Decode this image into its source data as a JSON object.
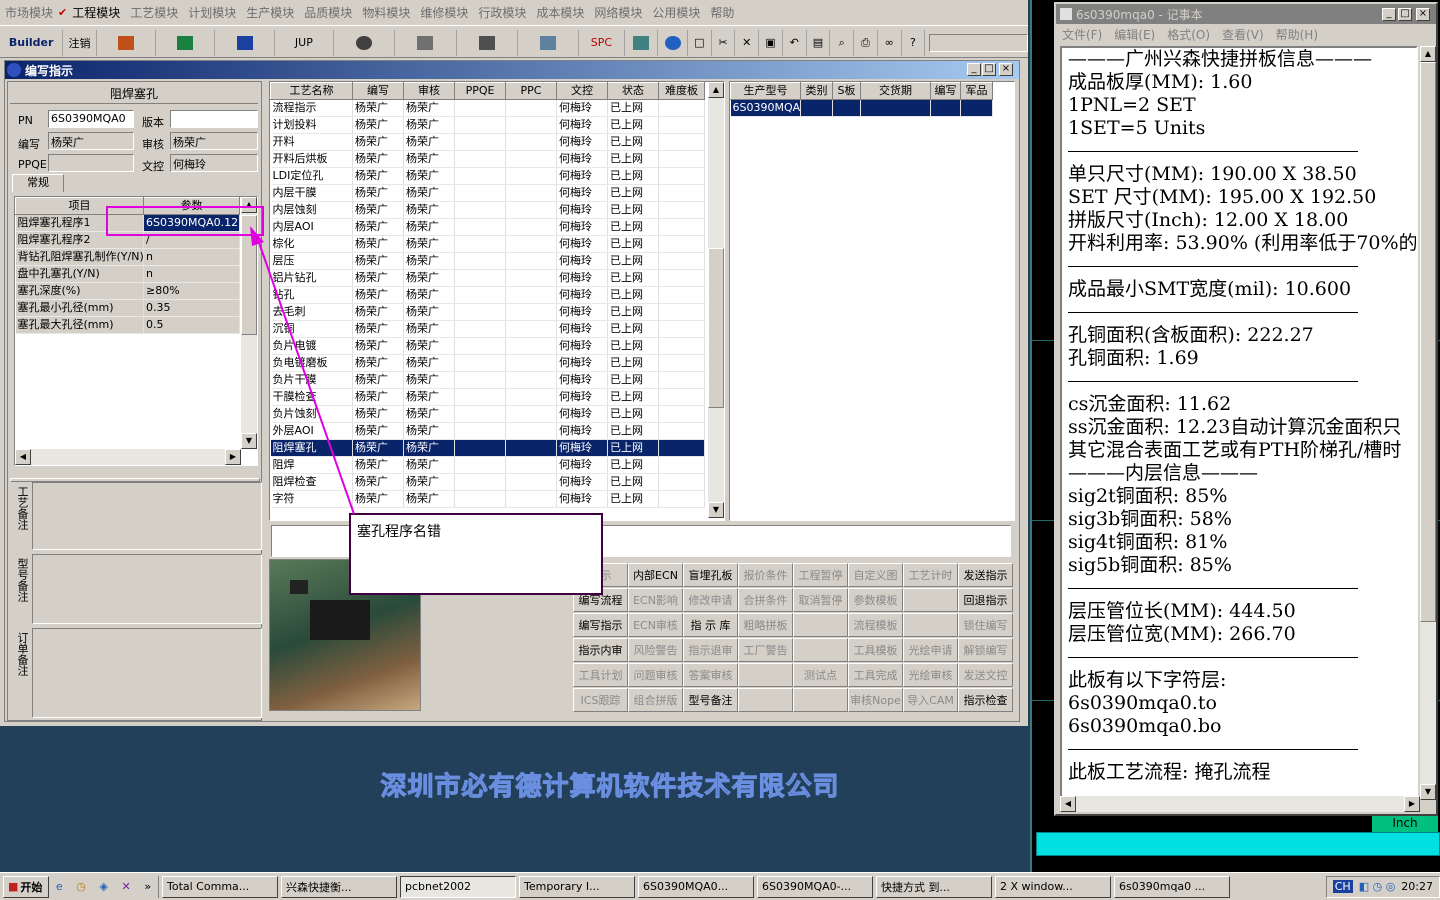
{
  "menubar": {
    "items": [
      "市场模块",
      "工程模块",
      "工艺模块",
      "计划模块",
      "生产模块",
      "品质模块",
      "物料模块",
      "维修模块",
      "行政模块",
      "成本模块",
      "网络模块",
      "公用模块",
      "帮助"
    ],
    "checked_index": 1
  },
  "toolbar": {
    "builder": "Builder",
    "logout": "注销",
    "jup": "JUP",
    "spc": "SPC"
  },
  "child_window": {
    "title": "编写指示",
    "panel_title": "阻焊塞孔",
    "fields": {
      "pn_label": "PN",
      "pn_value": "6S0390MQA0",
      "version_label": "版本",
      "version_value": "",
      "author_label": "编写",
      "author_value": "杨荣广",
      "review_label": "审核",
      "review_value": "杨荣广",
      "ppqe_label": "PPQE",
      "ppqe_value": "",
      "doc_label": "文控",
      "doc_value": "何梅玲"
    },
    "tab_general": "常规",
    "param_grid": {
      "headers": [
        "项目",
        "参数"
      ],
      "rows": [
        [
          "阻焊塞孔程序1",
          "6S0390MQA0.12"
        ],
        [
          "阻焊塞孔程序2",
          "/"
        ],
        [
          "背钻孔阻焊塞孔制作(Y/N)",
          "n"
        ],
        [
          "盘中孔塞孔(Y/N)",
          "n"
        ],
        [
          "塞孔深度(%)",
          "≥80%"
        ],
        [
          "塞孔最小孔径(mm)",
          "0.35"
        ],
        [
          "塞孔最大孔径(mm)",
          "0.5"
        ]
      ]
    },
    "notes": {
      "process_note": "工艺备注",
      "model_note": "型号备注",
      "order_note": "订单备注"
    },
    "process_grid": {
      "headers": [
        "工艺名称",
        "编写",
        "审核",
        "PPQE",
        "PPC",
        "文控",
        "状态",
        "难度板"
      ],
      "rows": [
        [
          "流程指示",
          "杨荣广",
          "杨荣广",
          "",
          "",
          "何梅玲",
          "已上网",
          ""
        ],
        [
          "计划投料",
          "杨荣广",
          "杨荣广",
          "",
          "",
          "何梅玲",
          "已上网",
          ""
        ],
        [
          "开料",
          "杨荣广",
          "杨荣广",
          "",
          "",
          "何梅玲",
          "已上网",
          ""
        ],
        [
          "开料后烘板",
          "杨荣广",
          "杨荣广",
          "",
          "",
          "何梅玲",
          "已上网",
          ""
        ],
        [
          "LDI定位孔",
          "杨荣广",
          "杨荣广",
          "",
          "",
          "何梅玲",
          "已上网",
          ""
        ],
        [
          "内层干膜",
          "杨荣广",
          "杨荣广",
          "",
          "",
          "何梅玲",
          "已上网",
          ""
        ],
        [
          "内层蚀刻",
          "杨荣广",
          "杨荣广",
          "",
          "",
          "何梅玲",
          "已上网",
          ""
        ],
        [
          "内层AOI",
          "杨荣广",
          "杨荣广",
          "",
          "",
          "何梅玲",
          "已上网",
          ""
        ],
        [
          "棕化",
          "杨荣广",
          "杨荣广",
          "",
          "",
          "何梅玲",
          "已上网",
          ""
        ],
        [
          "层压",
          "杨荣广",
          "杨荣广",
          "",
          "",
          "何梅玲",
          "已上网",
          ""
        ],
        [
          "铝片钻孔",
          "杨荣广",
          "杨荣广",
          "",
          "",
          "何梅玲",
          "已上网",
          ""
        ],
        [
          "钻孔",
          "杨荣广",
          "杨荣广",
          "",
          "",
          "何梅玲",
          "已上网",
          ""
        ],
        [
          "去毛刺",
          "杨荣广",
          "杨荣广",
          "",
          "",
          "何梅玲",
          "已上网",
          ""
        ],
        [
          "沉铜",
          "杨荣广",
          "杨荣广",
          "",
          "",
          "何梅玲",
          "已上网",
          ""
        ],
        [
          "负片电镀",
          "杨荣广",
          "杨荣广",
          "",
          "",
          "何梅玲",
          "已上网",
          ""
        ],
        [
          "负电镀磨板",
          "杨荣广",
          "杨荣广",
          "",
          "",
          "何梅玲",
          "已上网",
          ""
        ],
        [
          "负片干膜",
          "杨荣广",
          "杨荣广",
          "",
          "",
          "何梅玲",
          "已上网",
          ""
        ],
        [
          "干膜检查",
          "杨荣广",
          "杨荣广",
          "",
          "",
          "何梅玲",
          "已上网",
          ""
        ],
        [
          "负片蚀刻",
          "杨荣广",
          "杨荣广",
          "",
          "",
          "何梅玲",
          "已上网",
          ""
        ],
        [
          "外层AOI",
          "杨荣广",
          "杨荣广",
          "",
          "",
          "何梅玲",
          "已上网",
          ""
        ],
        [
          "阻焊塞孔",
          "杨荣广",
          "杨荣广",
          "",
          "",
          "何梅玲",
          "已上网",
          ""
        ],
        [
          "阻焊",
          "杨荣广",
          "杨荣广",
          "",
          "",
          "何梅玲",
          "已上网",
          ""
        ],
        [
          "阻焊检查",
          "杨荣广",
          "杨荣广",
          "",
          "",
          "何梅玲",
          "已上网",
          ""
        ],
        [
          "字符",
          "杨荣广",
          "杨荣广",
          "",
          "",
          "何梅玲",
          "已上网",
          ""
        ]
      ],
      "selected_index": 20
    },
    "product_grid": {
      "headers": [
        "生产型号",
        "类别",
        "S板",
        "交货期",
        "编写",
        "军品"
      ],
      "rows": [
        [
          "6S0390MQA0",
          "",
          "",
          "",
          "",
          ""
        ]
      ]
    },
    "callout": "塞孔程序名错",
    "action_buttons": [
      [
        "指示",
        "内部ECN",
        "盲埋孔板",
        "报价条件",
        "工程暂停",
        "自定义图",
        "工艺计时",
        "发送指示"
      ],
      [
        "编写流程",
        "ECN影响",
        "修改申请",
        "合拼条件",
        "取消暂停",
        "参数模板",
        "",
        "回退指示"
      ],
      [
        "编写指示",
        "ECN审核",
        "指 示 库",
        "粗略拼板",
        "",
        "流程模板",
        "",
        "锁住编写"
      ],
      [
        "指示内审",
        "风险警告",
        "指示退审",
        "工厂警告",
        "",
        "工具模板",
        "光绘申请",
        "解锁编写"
      ],
      [
        "工具计划",
        "问题审核",
        "答案审核",
        "",
        "测试点",
        "工具完成",
        "光绘审核",
        "发送文控"
      ],
      [
        "ICS跟踪",
        "组合拼版",
        "型号备注",
        "",
        "",
        "审核Nope",
        "导入CAM",
        "指示检查"
      ]
    ],
    "enabled_buttons": [
      "内部ECN",
      "盲埋孔板",
      "发送指示",
      "编写流程",
      "回退指示",
      "编写指示",
      "指 示 库",
      "指示内审",
      "型号备注",
      "指示检查"
    ]
  },
  "watermark": "深圳市必有德计算机软件技术有限公司",
  "notepad": {
    "title": "6s0390mqa0 - 记事本",
    "menu": [
      "文件(F)",
      "编辑(E)",
      "格式(O)",
      "查看(V)",
      "帮助(H)"
    ],
    "lines": [
      {
        "t": "———广州兴森快捷拼板信息———",
        "sep": false
      },
      {
        "t": "成品板厚(MM): 1.60",
        "sep": false
      },
      {
        "t": "1PNL=2 SET",
        "sep": false
      },
      {
        "t": "1SET=5 Units",
        "sep": false
      },
      {
        "t": "",
        "sep": true
      },
      {
        "t": "单只尺寸(MM): 190.00 X 38.50",
        "sep": false
      },
      {
        "t": "SET 尺寸(MM): 195.00 X 192.50",
        "sep": false
      },
      {
        "t": "拼版尺寸(Inch): 12.00 X 18.00",
        "sep": false
      },
      {
        "t": "开料利用率: 53.90% (利用率低于70%的",
        "sep": false
      },
      {
        "t": "",
        "sep": true
      },
      {
        "t": "成品最小SMT宽度(mil): 10.600",
        "sep": false
      },
      {
        "t": "",
        "sep": true
      },
      {
        "t": "孔铜面积(含板面积): 222.27",
        "sep": false
      },
      {
        "t": "孔铜面积: 1.69",
        "sep": false
      },
      {
        "t": "",
        "sep": true
      },
      {
        "t": "cs沉金面积: 11.62",
        "sep": false
      },
      {
        "t": "ss沉金面积: 12.23自动计算沉金面积只",
        "sep": false
      },
      {
        "t": "其它混合表面工艺或有PTH阶梯孔/槽时",
        "sep": false
      },
      {
        "t": "———内层信息———",
        "sep": false
      },
      {
        "t": "sig2t铜面积: 85%",
        "sep": false
      },
      {
        "t": "sig3b铜面积: 58%",
        "sep": false
      },
      {
        "t": "sig4t铜面积: 81%",
        "sep": false
      },
      {
        "t": "sig5b铜面积: 85%",
        "sep": false
      },
      {
        "t": "",
        "sep": true
      },
      {
        "t": "层压管位长(MM): 444.50",
        "sep": false
      },
      {
        "t": "层压管位宽(MM): 266.70",
        "sep": false
      },
      {
        "t": "",
        "sep": true
      },
      {
        "t": "此板有以下字符层:",
        "sep": false
      },
      {
        "t": "6s0390mqa0.to",
        "sep": false
      },
      {
        "t": "6s0390mqa0.bo",
        "sep": false
      },
      {
        "t": "",
        "sep": true
      },
      {
        "t": "此板工艺流程: 掩孔流程",
        "sep": false
      }
    ]
  },
  "inch_label": "Inch",
  "taskbar": {
    "start": "开始",
    "tasks": [
      "Total Comma...",
      "兴森快捷衡...",
      "pcbnet2002",
      "Temporary I...",
      "6S0390MQA0...",
      "6S0390MQA0-...",
      "快捷方式 到...",
      "2 X window...",
      "6s0390mqa0 ..."
    ],
    "active_index": 2,
    "ime": "CH",
    "clock": "20:27"
  },
  "colors": {
    "highlight": "#0a246a",
    "annotation": "#e000e0",
    "watermark": "#4a6fd0"
  }
}
